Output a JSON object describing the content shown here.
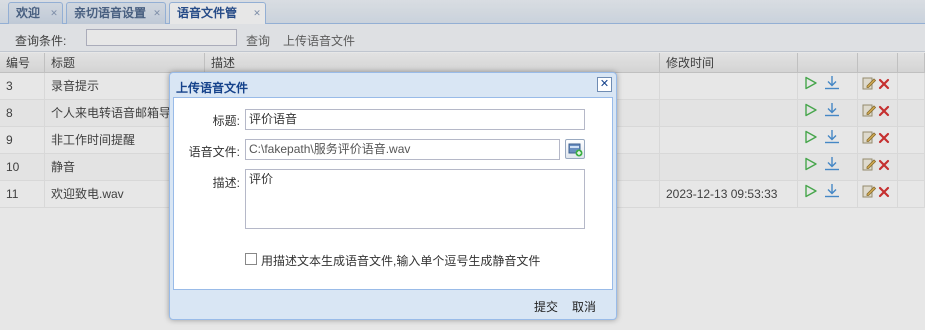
{
  "tabs": [
    {
      "label": "欢迎"
    },
    {
      "label": "亲切语音设置"
    },
    {
      "label": "语音文件管理"
    }
  ],
  "toolbar": {
    "query_label": "查询条件:",
    "query_value": "",
    "search_label": "查询",
    "upload_label": "上传语音文件"
  },
  "grid": {
    "columns": [
      "编号",
      "标题",
      "描述",
      "修改时间"
    ],
    "rows": [
      {
        "id": "3",
        "title": "录音提示",
        "desc": "",
        "time": ""
      },
      {
        "id": "8",
        "title": "个人来电转语音邮箱导",
        "desc": "",
        "time": ""
      },
      {
        "id": "9",
        "title": "非工作时间提醒",
        "desc": "",
        "time": ""
      },
      {
        "id": "10",
        "title": "静音",
        "desc": "",
        "time": ""
      },
      {
        "id": "11",
        "title": "欢迎致电.wav",
        "desc": "",
        "time": "2023-12-13 09:53:33"
      }
    ]
  },
  "dialog": {
    "title": "上传语音文件",
    "title_label": "标题:",
    "title_value": "评价语音",
    "file_label": "语音文件:",
    "file_value": "C:\\fakepath\\服务评价语音.wav",
    "desc_label": "描述:",
    "desc_value": "评价",
    "checkbox_label": "用描述文本生成语音文件,输入单个逗号生成静音文件",
    "submit_label": "提交",
    "cancel_label": "取消"
  },
  "colors": {
    "accent": "#15428b",
    "play": "#3cb043",
    "download": "#3a8ad6",
    "delete": "#d62020"
  }
}
